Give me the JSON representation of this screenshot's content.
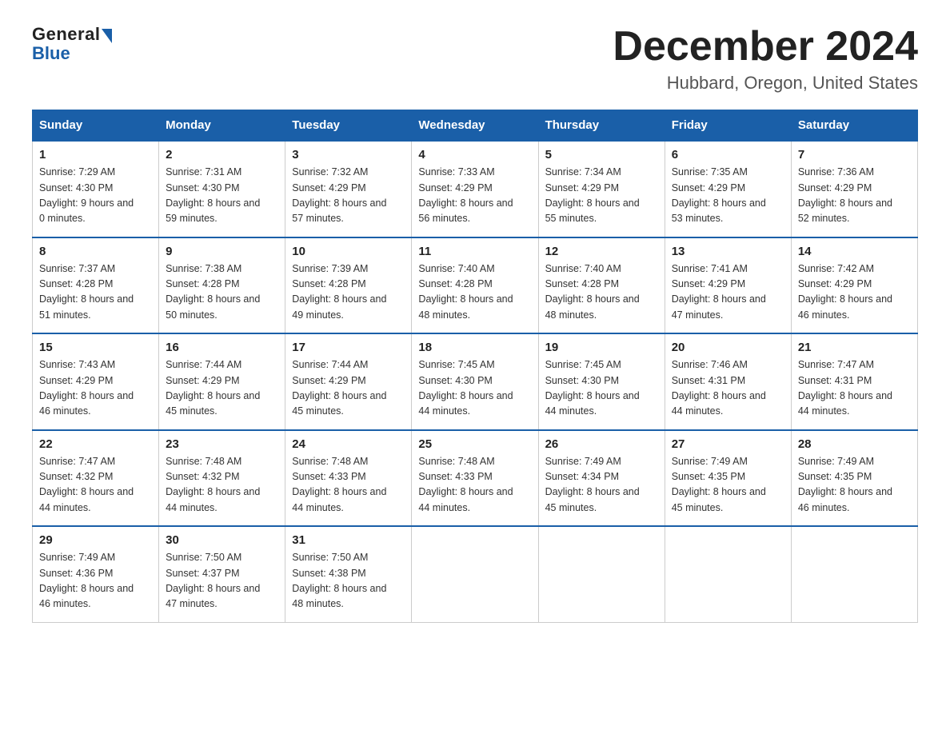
{
  "header": {
    "logo_general": "General",
    "logo_blue": "Blue",
    "month_title": "December 2024",
    "location": "Hubbard, Oregon, United States"
  },
  "days_of_week": [
    "Sunday",
    "Monday",
    "Tuesday",
    "Wednesday",
    "Thursday",
    "Friday",
    "Saturday"
  ],
  "weeks": [
    [
      {
        "num": "1",
        "sunrise": "7:29 AM",
        "sunset": "4:30 PM",
        "daylight": "9 hours and 0 minutes."
      },
      {
        "num": "2",
        "sunrise": "7:31 AM",
        "sunset": "4:30 PM",
        "daylight": "8 hours and 59 minutes."
      },
      {
        "num": "3",
        "sunrise": "7:32 AM",
        "sunset": "4:29 PM",
        "daylight": "8 hours and 57 minutes."
      },
      {
        "num": "4",
        "sunrise": "7:33 AM",
        "sunset": "4:29 PM",
        "daylight": "8 hours and 56 minutes."
      },
      {
        "num": "5",
        "sunrise": "7:34 AM",
        "sunset": "4:29 PM",
        "daylight": "8 hours and 55 minutes."
      },
      {
        "num": "6",
        "sunrise": "7:35 AM",
        "sunset": "4:29 PM",
        "daylight": "8 hours and 53 minutes."
      },
      {
        "num": "7",
        "sunrise": "7:36 AM",
        "sunset": "4:29 PM",
        "daylight": "8 hours and 52 minutes."
      }
    ],
    [
      {
        "num": "8",
        "sunrise": "7:37 AM",
        "sunset": "4:28 PM",
        "daylight": "8 hours and 51 minutes."
      },
      {
        "num": "9",
        "sunrise": "7:38 AM",
        "sunset": "4:28 PM",
        "daylight": "8 hours and 50 minutes."
      },
      {
        "num": "10",
        "sunrise": "7:39 AM",
        "sunset": "4:28 PM",
        "daylight": "8 hours and 49 minutes."
      },
      {
        "num": "11",
        "sunrise": "7:40 AM",
        "sunset": "4:28 PM",
        "daylight": "8 hours and 48 minutes."
      },
      {
        "num": "12",
        "sunrise": "7:40 AM",
        "sunset": "4:28 PM",
        "daylight": "8 hours and 48 minutes."
      },
      {
        "num": "13",
        "sunrise": "7:41 AM",
        "sunset": "4:29 PM",
        "daylight": "8 hours and 47 minutes."
      },
      {
        "num": "14",
        "sunrise": "7:42 AM",
        "sunset": "4:29 PM",
        "daylight": "8 hours and 46 minutes."
      }
    ],
    [
      {
        "num": "15",
        "sunrise": "7:43 AM",
        "sunset": "4:29 PM",
        "daylight": "8 hours and 46 minutes."
      },
      {
        "num": "16",
        "sunrise": "7:44 AM",
        "sunset": "4:29 PM",
        "daylight": "8 hours and 45 minutes."
      },
      {
        "num": "17",
        "sunrise": "7:44 AM",
        "sunset": "4:29 PM",
        "daylight": "8 hours and 45 minutes."
      },
      {
        "num": "18",
        "sunrise": "7:45 AM",
        "sunset": "4:30 PM",
        "daylight": "8 hours and 44 minutes."
      },
      {
        "num": "19",
        "sunrise": "7:45 AM",
        "sunset": "4:30 PM",
        "daylight": "8 hours and 44 minutes."
      },
      {
        "num": "20",
        "sunrise": "7:46 AM",
        "sunset": "4:31 PM",
        "daylight": "8 hours and 44 minutes."
      },
      {
        "num": "21",
        "sunrise": "7:47 AM",
        "sunset": "4:31 PM",
        "daylight": "8 hours and 44 minutes."
      }
    ],
    [
      {
        "num": "22",
        "sunrise": "7:47 AM",
        "sunset": "4:32 PM",
        "daylight": "8 hours and 44 minutes."
      },
      {
        "num": "23",
        "sunrise": "7:48 AM",
        "sunset": "4:32 PM",
        "daylight": "8 hours and 44 minutes."
      },
      {
        "num": "24",
        "sunrise": "7:48 AM",
        "sunset": "4:33 PM",
        "daylight": "8 hours and 44 minutes."
      },
      {
        "num": "25",
        "sunrise": "7:48 AM",
        "sunset": "4:33 PM",
        "daylight": "8 hours and 44 minutes."
      },
      {
        "num": "26",
        "sunrise": "7:49 AM",
        "sunset": "4:34 PM",
        "daylight": "8 hours and 45 minutes."
      },
      {
        "num": "27",
        "sunrise": "7:49 AM",
        "sunset": "4:35 PM",
        "daylight": "8 hours and 45 minutes."
      },
      {
        "num": "28",
        "sunrise": "7:49 AM",
        "sunset": "4:35 PM",
        "daylight": "8 hours and 46 minutes."
      }
    ],
    [
      {
        "num": "29",
        "sunrise": "7:49 AM",
        "sunset": "4:36 PM",
        "daylight": "8 hours and 46 minutes."
      },
      {
        "num": "30",
        "sunrise": "7:50 AM",
        "sunset": "4:37 PM",
        "daylight": "8 hours and 47 minutes."
      },
      {
        "num": "31",
        "sunrise": "7:50 AM",
        "sunset": "4:38 PM",
        "daylight": "8 hours and 48 minutes."
      },
      null,
      null,
      null,
      null
    ]
  ]
}
